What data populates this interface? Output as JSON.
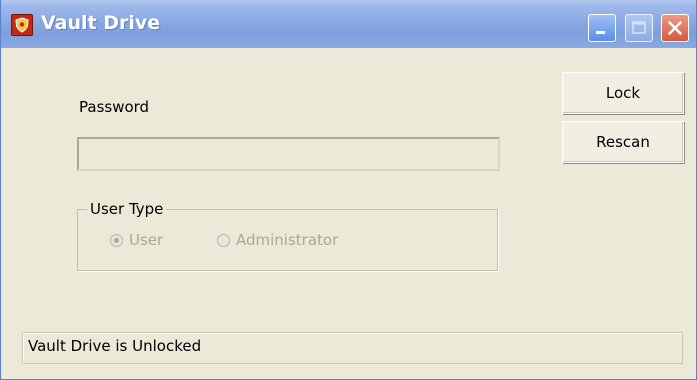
{
  "window": {
    "title": "Vault Drive",
    "title_color": "#ffffff",
    "titlebar_color": "#8aa9e3",
    "background_color": "#ece9d8",
    "controls": [
      {
        "name": "minimize",
        "icon": "minimize-icon"
      },
      {
        "name": "maximize",
        "icon": "maximize-icon",
        "enabled": false
      },
      {
        "name": "close",
        "icon": "close-icon"
      }
    ]
  },
  "form": {
    "password_label": "Password",
    "password_value": ""
  },
  "buttons": {
    "lock_label": "Lock",
    "rescan_label": "Rescan"
  },
  "user_type": {
    "group_title": "User Type",
    "options": [
      {
        "label": "User",
        "selected": true,
        "enabled": false
      },
      {
        "label": "Administrator",
        "selected": false,
        "enabled": false
      }
    ],
    "disabled_text_color": "#aca899"
  },
  "status": {
    "text": "Vault Drive is Unlocked"
  }
}
